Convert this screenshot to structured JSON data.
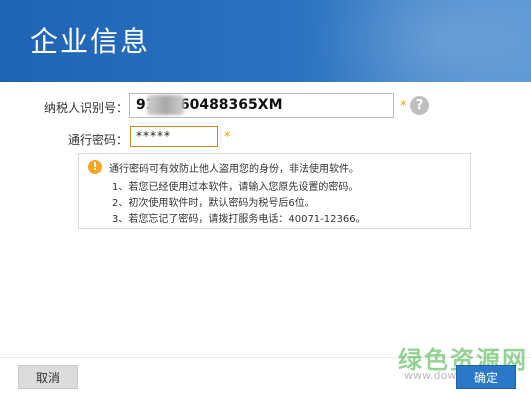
{
  "header": {
    "title": "企业信息"
  },
  "form": {
    "taxid_label": "纳税人识别号：",
    "taxid_value": "91      0060488365XM",
    "password_label": "通行密码：",
    "password_value": "*****",
    "required_mark": "*",
    "help_glyph": "?"
  },
  "notice": {
    "icon_glyph": "!",
    "lines": [
      "通行密码可有效防止他人盗用您的身份，非法使用软件。",
      "1、若您已经使用过本软件，请输入您原先设置的密码。",
      "2、初次使用软件时，默认密码为税号后6位。",
      "3、若您忘记了密码，请拨打服务电话：40071-12366。"
    ]
  },
  "buttons": {
    "cancel": "取消",
    "ok": "确定"
  },
  "watermark": {
    "text": "绿色资源网",
    "url": "www.downcc.com"
  },
  "colors": {
    "header_blue": "#2a72c0",
    "accent_orange": "#f0a000",
    "ok_button": "#2b78c8"
  }
}
